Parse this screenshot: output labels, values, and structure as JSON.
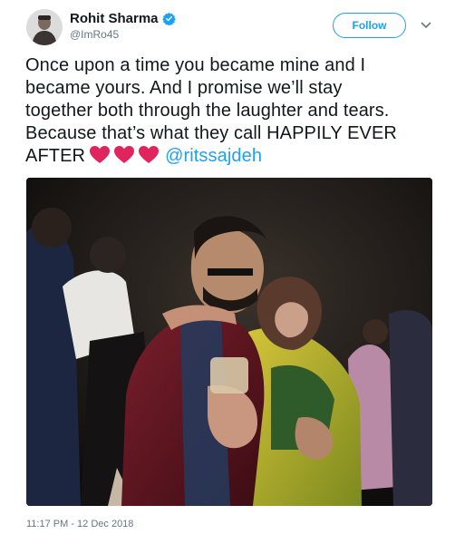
{
  "author": {
    "display_name": "Rohit Sharma",
    "handle": "@ImRo45",
    "verified": true,
    "avatar_icon": "profile-photo"
  },
  "follow_label": "Follow",
  "menu_icon": "chevron-down-icon",
  "tweet": {
    "lines": [
      "Once upon a time you became mine and I",
      "became yours. And I promise we’ll stay",
      "together both through the laughter and tears.",
      "Because that’s what they call HAPPILY EVER"
    ],
    "last_line_prefix": "AFTER",
    "heart_count": 3,
    "mention": "@ritssajdeh"
  },
  "timestamp": "11:17 PM - 12 Dec 2018",
  "colors": {
    "accent": "#1da1f2",
    "text": "#14171a",
    "muted": "#657786",
    "heart": "#e0245e"
  }
}
